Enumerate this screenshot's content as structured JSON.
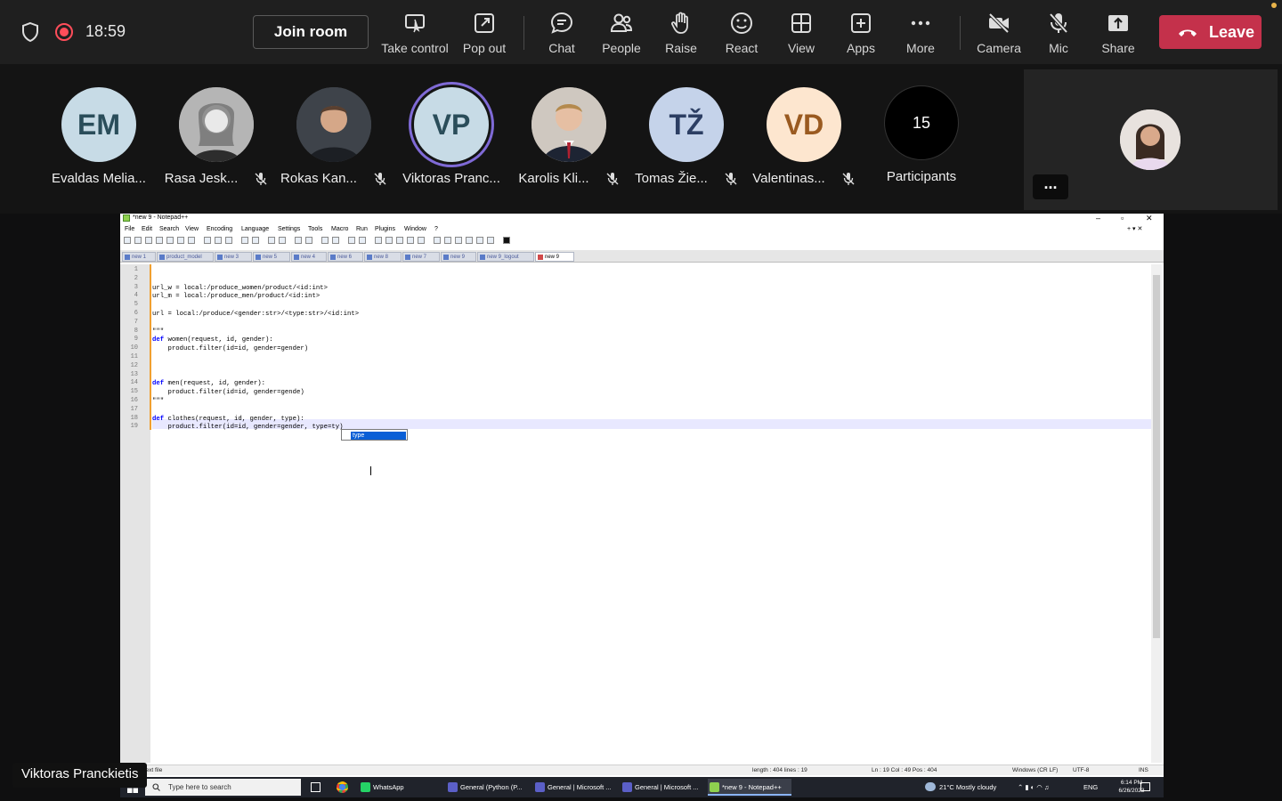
{
  "meeting": {
    "timer": "18:59",
    "join_label": "Join room",
    "leave_label": "Leave",
    "toolbar": [
      {
        "label": "Take control",
        "icon": "take-control-icon"
      },
      {
        "label": "Pop out",
        "icon": "pop-out-icon"
      },
      {
        "label": "Chat",
        "icon": "chat-icon"
      },
      {
        "label": "People",
        "icon": "people-icon"
      },
      {
        "label": "Raise",
        "icon": "raise-hand-icon"
      },
      {
        "label": "React",
        "icon": "react-icon"
      },
      {
        "label": "View",
        "icon": "view-icon"
      },
      {
        "label": "Apps",
        "icon": "apps-icon"
      },
      {
        "label": "More",
        "icon": "more-icon"
      },
      {
        "label": "Camera",
        "icon": "camera-off-icon"
      },
      {
        "label": "Mic",
        "icon": "mic-off-icon"
      },
      {
        "label": "Share",
        "icon": "share-icon"
      }
    ],
    "leave_color": "#c4314b"
  },
  "participants": [
    {
      "initials": "EM",
      "name": "Evaldas Melia...",
      "muted": false,
      "bg": "#c7dbe6",
      "fg": "#2a4d5a"
    },
    {
      "initials": "",
      "name": "Rasa Jesk...",
      "muted": true,
      "bg": "#9a9a9a",
      "fg": "#fff"
    },
    {
      "initials": "",
      "name": "Rokas Kan...",
      "muted": true,
      "bg": "#4a4e55",
      "fg": "#fff"
    },
    {
      "initials": "VP",
      "name": "Viktoras Pranc...",
      "muted": false,
      "bg": "#c7dbe6",
      "fg": "#2a4d5a",
      "speaking": true
    },
    {
      "initials": "",
      "name": "Karolis Kli...",
      "muted": true,
      "bg": "#b8b0a8",
      "fg": "#fff"
    },
    {
      "initials": "TŽ",
      "name": "Tomas Žie...",
      "muted": true,
      "bg": "#c5d3ea",
      "fg": "#2c3e63"
    },
    {
      "initials": "VD",
      "name": "Valentinas...",
      "muted": true,
      "bg": "#fde6cf",
      "fg": "#9a5a20"
    },
    {
      "initials": "15",
      "name": "Participants",
      "muted": false,
      "bg": "#000000",
      "fg": "#ffffff"
    }
  ],
  "self_view": {
    "more_label": "..."
  },
  "speaker_label": "Viktoras Pranckietis",
  "notepad": {
    "title": "*new 9 - Notepad++",
    "menu": [
      "File",
      "Edit",
      "Search",
      "View",
      "Encoding",
      "Language",
      "Settings",
      "Tools",
      "Macro",
      "Run",
      "Plugins",
      "Window",
      "?"
    ],
    "tabs": [
      "new 1",
      "product_model",
      "new 3",
      "new 5",
      "new 4",
      "new 6",
      "new 8",
      "new 7",
      "new 9",
      "new 9_logout",
      "new 9"
    ],
    "lines": [
      "",
      "",
      "url_w = local:/produce_women/product/<id:int>",
      "url_m = local:/produce_men/product/<id:int>",
      "",
      "url = local:/produce/<gender:str>/<type:str>/<id:int>",
      "",
      "\"\"\"",
      "def women(request, id, gender):",
      "    product.filter(id=id, gender=gender)",
      "",
      "",
      "",
      "def men(request, id, gender):",
      "    product.filter(id=id, gender=gende)",
      "\"\"\"",
      "",
      "def clothes(request, id, gender, type):",
      "    product.filter(id=id, gender=gender, type=ty)"
    ],
    "autocomplete": "type",
    "status": {
      "doc_type": "Normal text file",
      "length": "length : 404    lines : 19",
      "position": "Ln : 19    Col : 49    Pos : 404",
      "eol": "Windows (CR LF)",
      "encoding": "UTF-8",
      "mode": "INS"
    }
  },
  "taskbar": {
    "search_placeholder": "Type here to search",
    "apps": [
      {
        "label": "WhatsApp",
        "color": "#25d366"
      },
      {
        "label": "General (Python (P...",
        "color": "#5b5fc7"
      },
      {
        "label": "General | Microsoft ...",
        "color": "#5b5fc7"
      },
      {
        "label": "General | Microsoft ...",
        "color": "#5b5fc7"
      },
      {
        "label": "*new 9 - Notepad++",
        "color": "#8fd14f"
      }
    ],
    "weather": "21°C  Mostly cloudy",
    "lang": "ENG",
    "time": "6:14 PM",
    "date": "6/26/2023"
  }
}
